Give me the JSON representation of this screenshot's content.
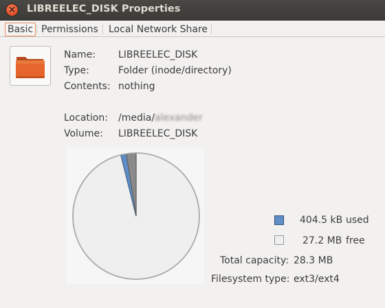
{
  "window": {
    "title": "LIBREELEC_DISK Properties",
    "close_glyph": "×"
  },
  "tabs": [
    {
      "label": "Basic",
      "active": true
    },
    {
      "label": "Permissions",
      "active": false
    },
    {
      "label": "Local Network Share",
      "active": false
    }
  ],
  "icon": {
    "name": "folder-icon",
    "color": "#e3642c"
  },
  "basic": {
    "name_label": "Name:",
    "name_value": "LIBREELEC_DISK",
    "type_label": "Type:",
    "type_value": "Folder (inode/directory)",
    "contents_label": "Contents:",
    "contents_value": "nothing",
    "location_label": "Location:",
    "location_prefix": "/media/",
    "location_user": "alexander",
    "volume_label": "Volume:",
    "volume_value": "LIBREELEC_DISK"
  },
  "usage": {
    "used_value": "404.5 kB",
    "used_label": "used",
    "used_color": "#5f8ec6",
    "free_value": "27.2 MB",
    "free_label": "free",
    "free_color": "#efefef",
    "total_label": "Total capacity:",
    "total_value": "28.3 MB",
    "fs_label": "Filesystem type:",
    "fs_value": "ext3/ext4"
  },
  "chart_data": {
    "type": "pie",
    "slices": [
      {
        "label": "used",
        "value": 404.5,
        "unit": "kB",
        "color": "#5f8ec6"
      },
      {
        "label": "free",
        "value": 27200,
        "unit": "kB",
        "color": "#efefef"
      },
      {
        "label": "reserved",
        "value": 700,
        "unit": "kB",
        "color": "#8a8a8a"
      }
    ]
  }
}
